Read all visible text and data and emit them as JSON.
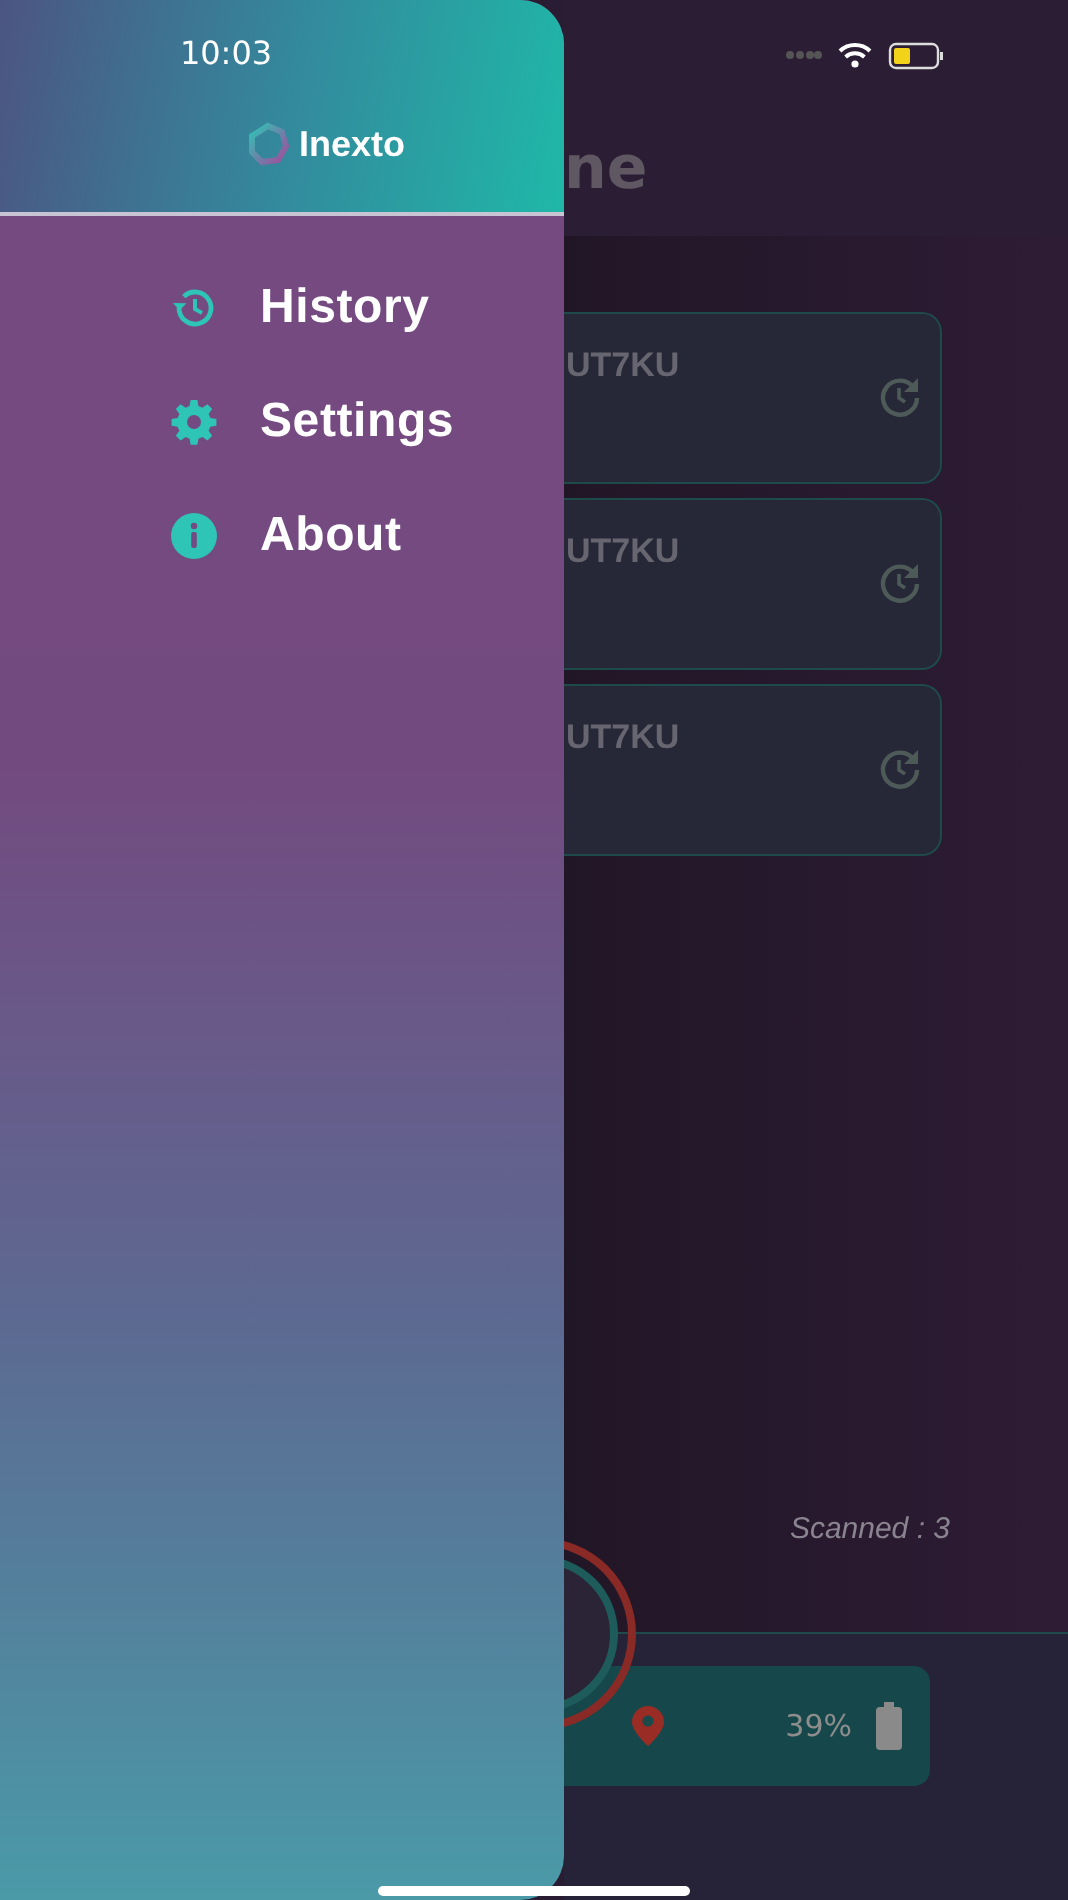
{
  "status_bar": {
    "time": "10:03"
  },
  "drawer": {
    "brand": "Inexto",
    "items": [
      {
        "label": "History",
        "kind": "history"
      },
      {
        "label": "Settings",
        "kind": "settings"
      },
      {
        "label": "About",
        "kind": "about"
      }
    ]
  },
  "screen": {
    "title": "ne",
    "scans": [
      {
        "code": "UT7KU"
      },
      {
        "code": "UT7KU"
      },
      {
        "code": "UT7KU"
      }
    ],
    "scanned": "Scanned : 3",
    "battery": "39%"
  }
}
